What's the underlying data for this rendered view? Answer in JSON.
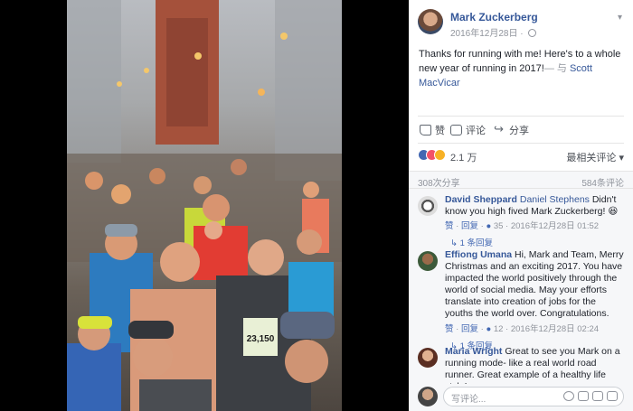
{
  "post": {
    "author": "Mark Zuckerberg",
    "timestamp": "2016年12月28日",
    "text_main": "Thanks for running with me! Here's to a whole new year of running in 2017!",
    "text_with": "— 与",
    "tagged": "Scott MacVicar"
  },
  "actions": {
    "like": "赞",
    "comment": "评论",
    "share": "分享"
  },
  "reactions": {
    "count": "2.1 万",
    "sort_label": "最相关评论 ▾"
  },
  "stats": {
    "shares": "308次分享",
    "comments": "584条评论"
  },
  "comments": [
    {
      "name": "David Sheppard",
      "mention": "Daniel Stephens",
      "text": "Didn't know you high fived Mark Zuckerberg! 😆",
      "like_label": "赞",
      "reply_label": "回复",
      "likes": "35",
      "time": "2016年12月28日 01:52",
      "replies": "1 条回复"
    },
    {
      "name": "Effiong Umana",
      "mention": "",
      "text": "Hi, Mark and Team, Merry Christmas and an exciting 2017. You have impacted the world positively through the world of social media. May your efforts translate into creation of jobs for the youths the world over. Congratulations.",
      "like_label": "赞",
      "reply_label": "回复",
      "likes": "12",
      "time": "2016年12月28日 02:24",
      "replies": "1 条回复"
    },
    {
      "name": "Maria Wright",
      "mention": "",
      "text": "Great to see you Mark on a running mode- like a real world road runner. Great example of a healthy life style!"
    }
  ],
  "composer": {
    "placeholder": "写评论..."
  },
  "photo": {
    "bib1": "23,150"
  },
  "colors": {
    "link": "#365899",
    "like_blue": "#4267b2",
    "love_red": "#f25268",
    "wow_yellow": "#f7b125"
  }
}
